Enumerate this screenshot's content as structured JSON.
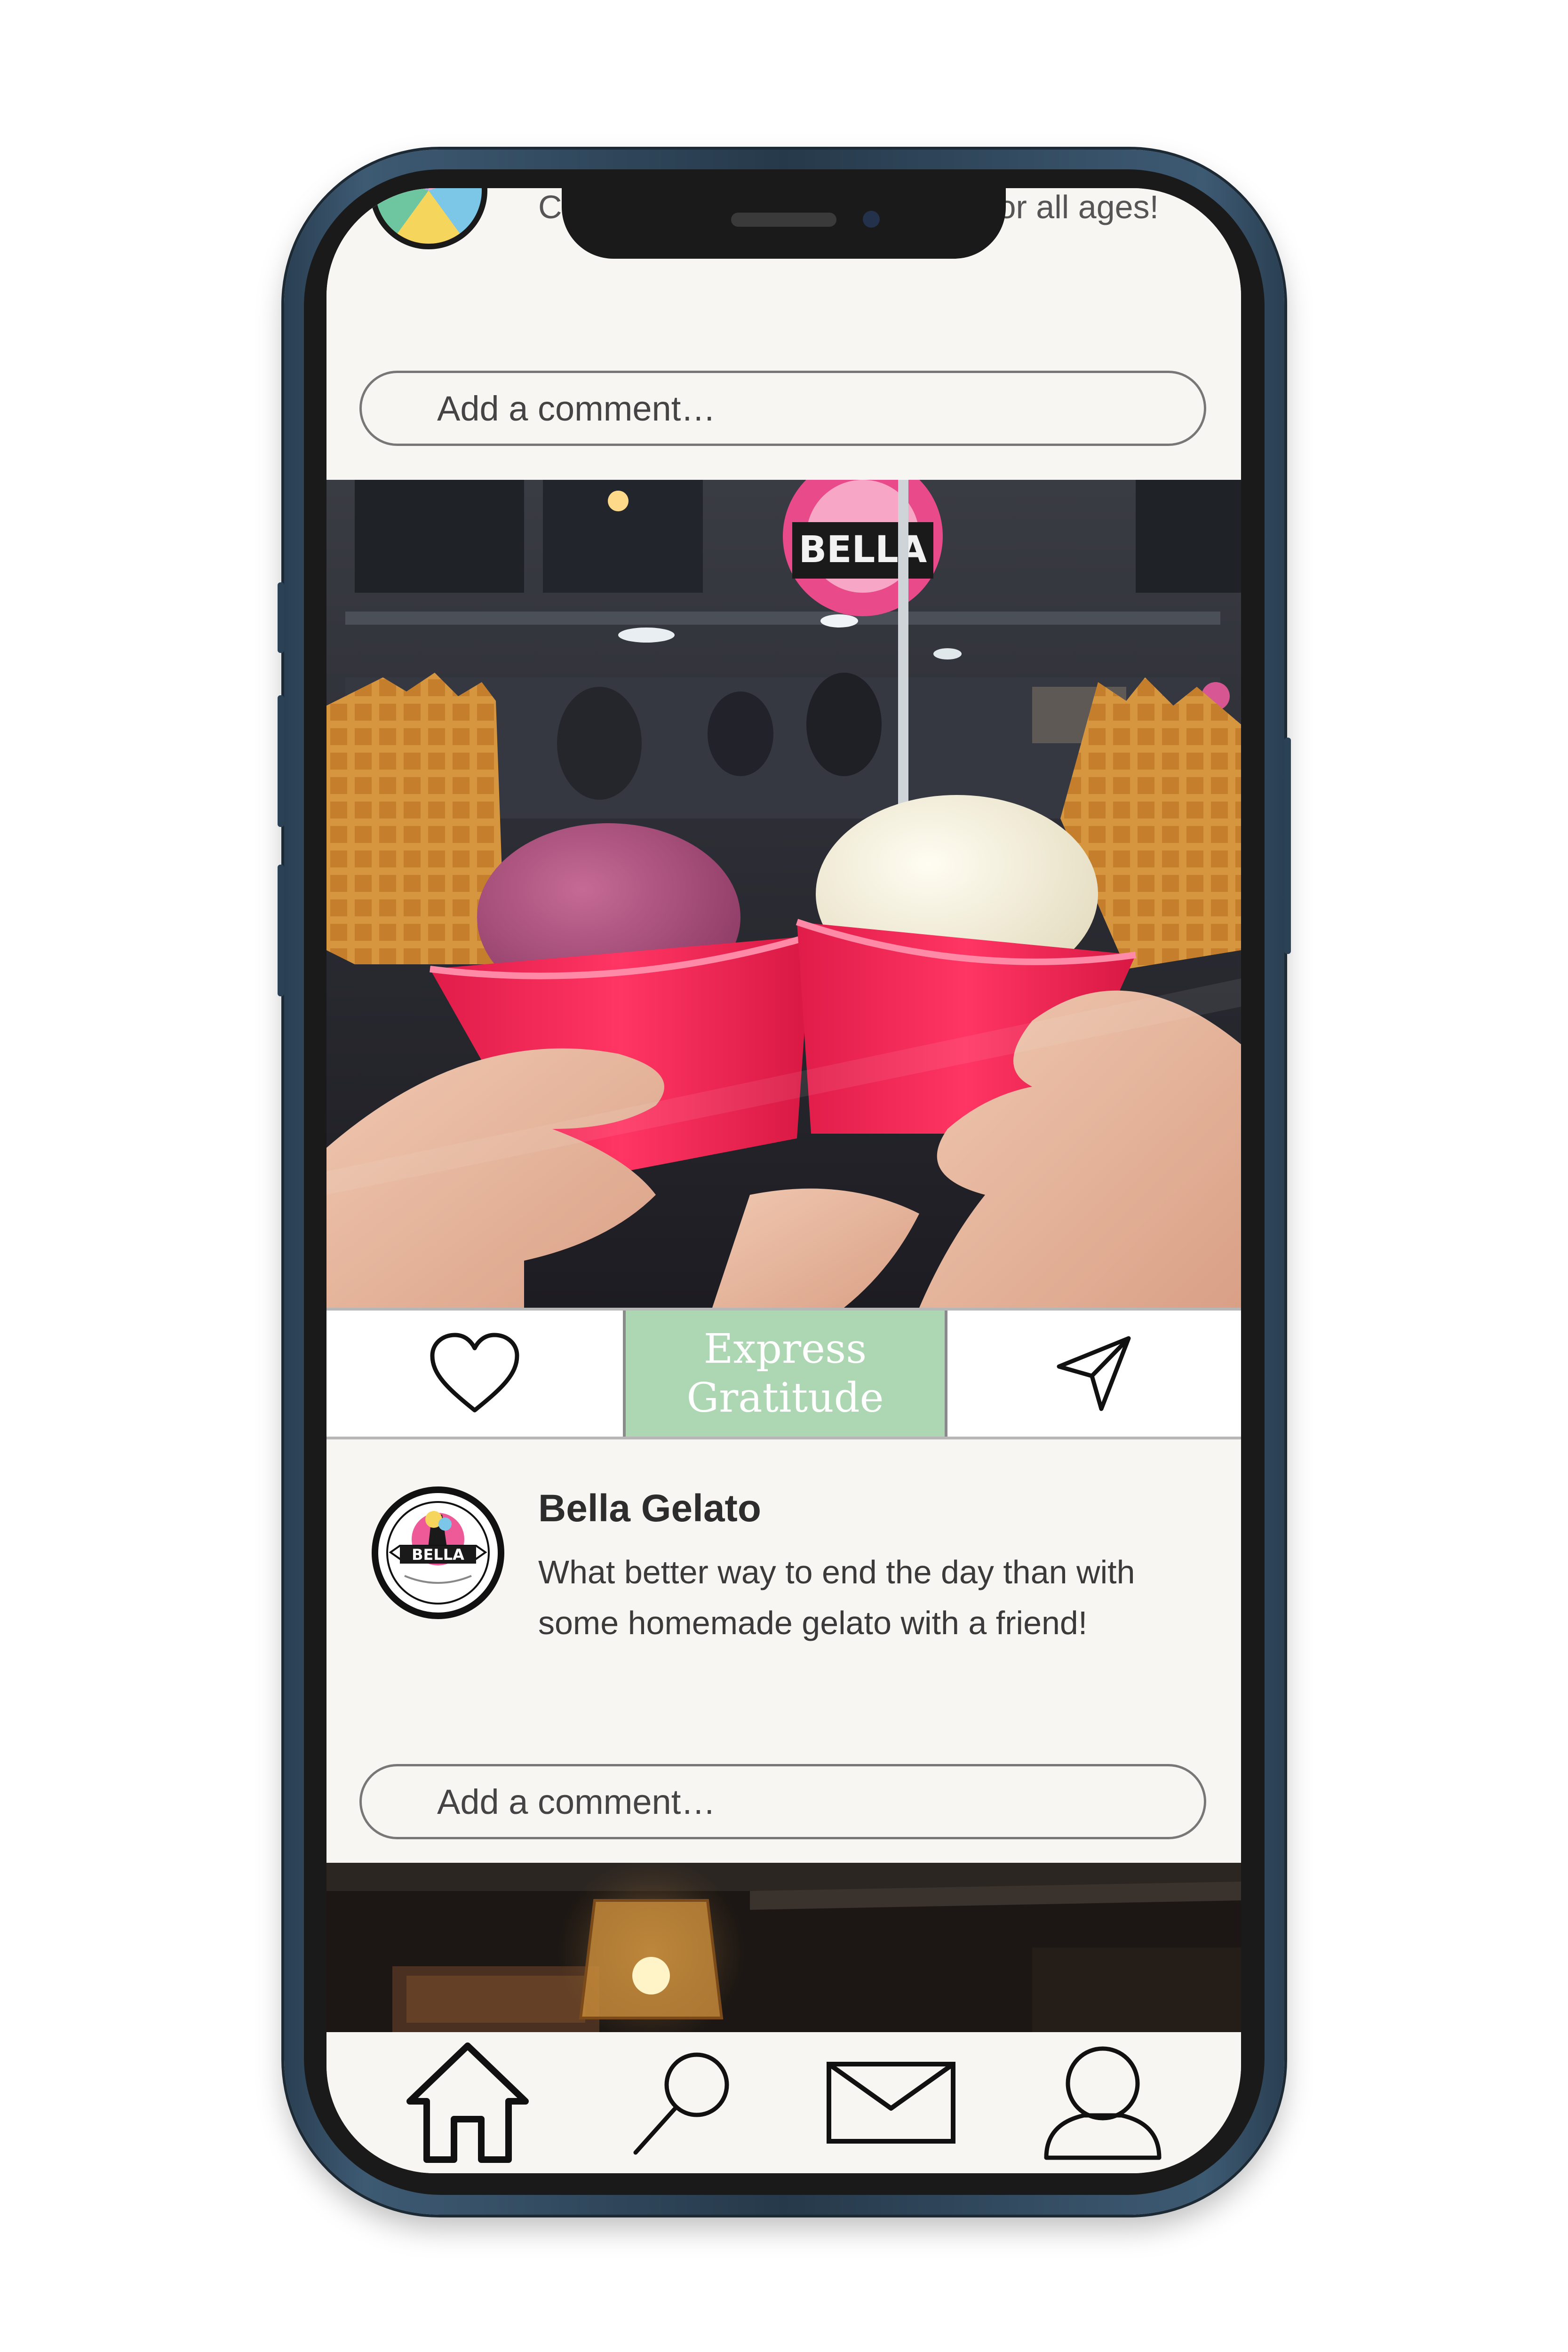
{
  "previous_post": {
    "text": "Check out our new line of toys for all ages!",
    "comment_placeholder": "Add a comment…"
  },
  "post": {
    "photo_sign_text": "BELLA",
    "actions": {
      "like_icon": "heart-icon",
      "gratitude_label": "Express Gratitude",
      "share_icon": "send-icon"
    },
    "author": "Bella Gelato",
    "avatar_text": "BELLA",
    "caption": "What better way to end the day than with some homemade gelato with a friend!",
    "comment_placeholder": "Add a comment…"
  },
  "tab_bar": {
    "items": [
      {
        "icon": "home-icon",
        "active": true
      },
      {
        "icon": "search-icon",
        "active": false
      },
      {
        "icon": "mail-icon",
        "active": false
      },
      {
        "icon": "profile-icon",
        "active": false
      }
    ]
  },
  "colors": {
    "gratitude_bg": "#add7b3",
    "screen_bg": "#f8f6f3",
    "cup_pink": "#f52a58",
    "frame": "#2f475b"
  }
}
